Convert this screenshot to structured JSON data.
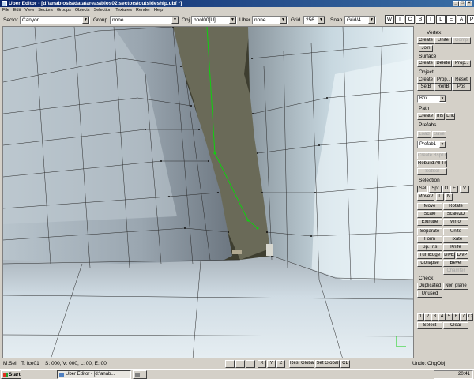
{
  "window": {
    "title": "Uber Editor - [d:\\anabiosis\\data\\areas\\bios02\\sectors\\outsideship.ubf *]",
    "controls": [
      "_",
      "□",
      "×"
    ]
  },
  "menu": [
    "File",
    "Edit",
    "View",
    "Sectors",
    "Groups",
    "Objects",
    "Selection",
    "Textures",
    "Render",
    "Help"
  ],
  "toolbar": {
    "sector_label": "Sector",
    "sector_value": "Canyon",
    "group_label": "Group",
    "group_value": "none",
    "obj_label": "Obj",
    "obj_value": "bool00[U]",
    "uber_label": "Uber",
    "uber_value": "none",
    "grid_label": "Grid",
    "grid_value": "256",
    "snap_label": "Snap",
    "snap_value": "Grid/4",
    "view_buttons": [
      "W",
      "T",
      "C",
      "B",
      "T",
      "L",
      "E",
      "A",
      "P"
    ]
  },
  "panel": {
    "vertex": {
      "title": "Vertex",
      "create": "Create",
      "unite": "Unite",
      "gomp": "Gomp",
      "join": "Join"
    },
    "surface": {
      "title": "Surface",
      "create": "Create",
      "delete": "Delete",
      "prop": "Prop.."
    },
    "object": {
      "title": "Object",
      "create": "Create",
      "prop": "Prop..",
      "reset": "Reset",
      "setb": "SetB",
      "renb": "RenB",
      "pos": "Pos",
      "type": "Box"
    },
    "path": {
      "title": "Path",
      "create": "Create",
      "ins": "Ins",
      "lnk": "Lnk"
    },
    "prefabs": {
      "title": "Prefabs",
      "load": "Load",
      "save": "Save",
      "selected": "Prefab1"
    },
    "tree": {
      "create_bsptree": "Create BspTree",
      "rebuild": "Rebuild All Tree",
      "setsel": "SetSel"
    },
    "selection": {
      "title": "Selection",
      "row1": [
        "Sel",
        "Spr",
        "O",
        "F",
        "V"
      ],
      "row2": [
        "MoveV",
        "L",
        "N"
      ],
      "grid": [
        "Move",
        "Rotate",
        "Scale",
        "Scale2D",
        "Extrude",
        "Mirror",
        "Separate",
        "Unite",
        "Form",
        "Fixate",
        "Sp.Tris",
        "Knife"
      ],
      "row_turn": [
        "TurnEdge",
        "DivE",
        "DivP"
      ],
      "collapse": "Collapse",
      "bevel": "Bevel",
      "chamfer": "Chamfer"
    },
    "check": {
      "title": "Check",
      "duplicated": "Duplicated",
      "non_plane": "Non plane",
      "unused": "Unused"
    },
    "layers": {
      "numbers": [
        "1",
        "2",
        "3",
        "4",
        "5",
        "6",
        "7"
      ],
      "c_label": "C",
      "select": "Select",
      "clear": "Clear"
    }
  },
  "status": {
    "mode": "M:Sel",
    "texture": "T: Ice01",
    "coords": "S: 000, V: 000, L: 00, E: 00",
    "axis_x": "X",
    "axis_y": "Y",
    "axis_z": "Z",
    "res_global": "Res: Global",
    "set_global": "Set Global",
    "cl": "CL",
    "undo": "Undo: ChgObj"
  },
  "taskbar": {
    "start": "Start",
    "task1": "Uber Editor - [d:\\anab...",
    "task2": "",
    "clock": "20:41"
  },
  "colors": {
    "titlebar": "#0a246a",
    "face": "#d4d0c8",
    "viewport_background": "#3e3e30",
    "green_path": "#10d010"
  }
}
